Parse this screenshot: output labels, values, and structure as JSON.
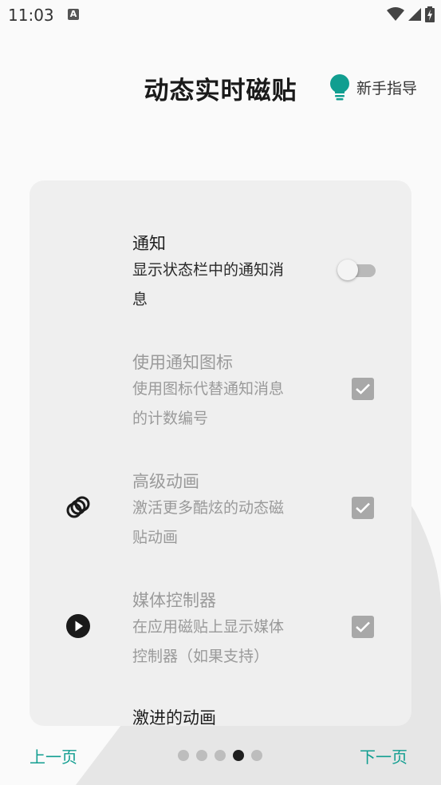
{
  "status_bar": {
    "time": "11:03",
    "notification_icon": "A"
  },
  "header": {
    "title": "动态实时磁贴",
    "guide_label": "新手指导",
    "guide_icon": "lightbulb-icon",
    "accent_color": "#119e90"
  },
  "settings": [
    {
      "title": "通知",
      "desc_line1": "显示状态栏中的通知消",
      "desc_line2": "息",
      "control": "toggle",
      "enabled": true,
      "checked": false
    },
    {
      "title": "使用通知图标",
      "desc_line1": "使用图标代替通知消息",
      "desc_line2": "的计数编号",
      "control": "checkbox",
      "enabled": false,
      "checked": true
    },
    {
      "title": "高级动画",
      "desc_line1": "激活更多酷炫的动态磁",
      "desc_line2": "贴动画",
      "icon": "rings-icon",
      "control": "checkbox",
      "enabled": false,
      "checked": true
    },
    {
      "title": "媒体控制器",
      "desc_line1": "在应用磁贴上显示媒体",
      "desc_line2": "控制器（如果支持）",
      "icon": "play-icon",
      "control": "checkbox",
      "enabled": false,
      "checked": true
    },
    {
      "title": "激进的动画"
    }
  ],
  "nav": {
    "prev_label": "上一页",
    "next_label": "下一页",
    "page_count": 5,
    "current_page": 4
  }
}
